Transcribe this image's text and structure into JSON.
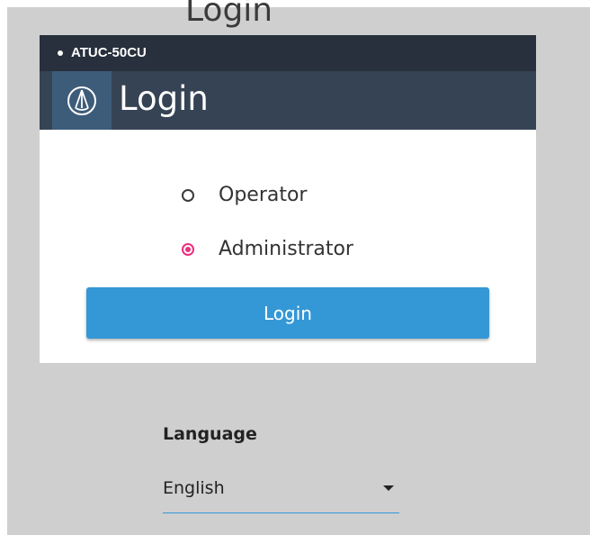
{
  "background_title": "Login",
  "device": {
    "name": "ATUC-50CU"
  },
  "header": {
    "logo": "audio-technica-logo-icon",
    "title": "Login"
  },
  "roles": [
    {
      "label": "Operator",
      "selected": false
    },
    {
      "label": "Administrator",
      "selected": true
    }
  ],
  "login_button": {
    "label": "Login"
  },
  "language": {
    "label": "Language",
    "selected": "English"
  },
  "colors": {
    "topbar": "#27303c",
    "header": "#364354",
    "logo_box": "#3d5c7a",
    "accent_blue": "#3498d6",
    "radio_selected": "#ea2f7f",
    "page_background": "#cfcfcf"
  }
}
